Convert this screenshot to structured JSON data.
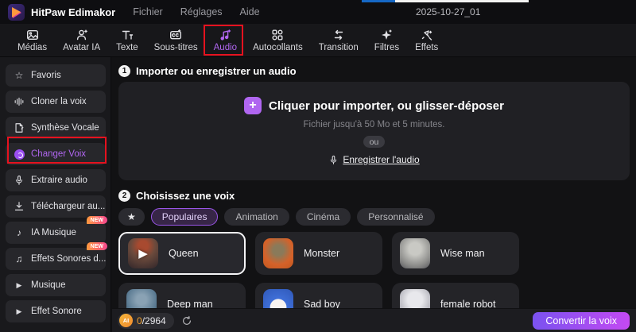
{
  "titlebar": {
    "app_name": "HitPaw Edimakor",
    "menus": [
      {
        "label": "Fichier"
      },
      {
        "label": "Réglages"
      },
      {
        "label": "Aide"
      }
    ],
    "document_title": "2025-10-27_01"
  },
  "tabbar": {
    "active_tab": "Audio",
    "tabs": [
      {
        "label": "Médias"
      },
      {
        "label": "Avatar IA"
      },
      {
        "label": "Texte"
      },
      {
        "label": "Sous-titres"
      },
      {
        "label": "Audio"
      },
      {
        "label": "Autocollants"
      },
      {
        "label": "Transition"
      },
      {
        "label": "Filtres"
      },
      {
        "label": "Effets"
      }
    ]
  },
  "sidebar": {
    "active_item": "Changer Voix",
    "items": [
      {
        "label": "Favoris"
      },
      {
        "label": "Cloner la voix"
      },
      {
        "label": "Synthèse Vocale"
      },
      {
        "label": "Changer Voix"
      },
      {
        "label": "Extraire audio"
      },
      {
        "label": "Téléchargeur au..."
      },
      {
        "label": "IA Musique",
        "badge": "NEW"
      },
      {
        "label": "Effets Sonores d...",
        "badge": "NEW"
      },
      {
        "label": "Musique"
      },
      {
        "label": "Effet Sonore"
      }
    ]
  },
  "main": {
    "step1": {
      "number": "1",
      "title": "Importer ou enregistrer un audio",
      "dropzone": {
        "plus": "+",
        "cta": "Cliquer pour importer, ou glisser-déposer",
        "hint": "Fichier jusqu'à 50 Mo et 5 minutes.",
        "or_label": "ou",
        "record_label": "Enregistrer l'audio"
      }
    },
    "step2": {
      "number": "2",
      "title": "Choisissez une voix",
      "selected_filter": "Populaires",
      "filters": [
        {
          "label": "Populaires"
        },
        {
          "label": "Animation"
        },
        {
          "label": "Cinéma"
        },
        {
          "label": "Personnalisé"
        }
      ],
      "voices": [
        {
          "name": "Queen",
          "selected": true
        },
        {
          "name": "Monster",
          "selected": false
        },
        {
          "name": "Wise man",
          "selected": false
        },
        {
          "name": "Deep man",
          "selected": false
        },
        {
          "name": "Sad boy",
          "selected": false
        },
        {
          "name": "female robot",
          "selected": false
        }
      ]
    }
  },
  "footer": {
    "ai_badge": "AI",
    "credits_used": "0",
    "credits_total": "/2964",
    "convert_label": "Convertir la voix"
  },
  "icons": {
    "star": "☆",
    "star_filled": "★",
    "play": "▶",
    "note": "♪",
    "notes": "♫",
    "media": "media-icon",
    "avatar": "avatar-icon",
    "text": "text-icon",
    "subtitles": "cc-icon",
    "audio": "music-note-icon",
    "stickers": "stickers-icon",
    "transition": "transition-arrows-icon",
    "filters": "sparkle-icon",
    "effects": "wand-icon",
    "mic": "microphone-icon",
    "download": "download-icon",
    "refresh": "refresh-icon"
  },
  "colors": {
    "accent_purple": "#b066f0",
    "annotation_red": "#e6121f",
    "convert_gradient_start": "#7a52f0",
    "convert_gradient_end": "#c44af2",
    "new_badge_start": "#ff9a3d",
    "new_badge_end": "#f5468f",
    "ai_orange": "#f0a030"
  }
}
